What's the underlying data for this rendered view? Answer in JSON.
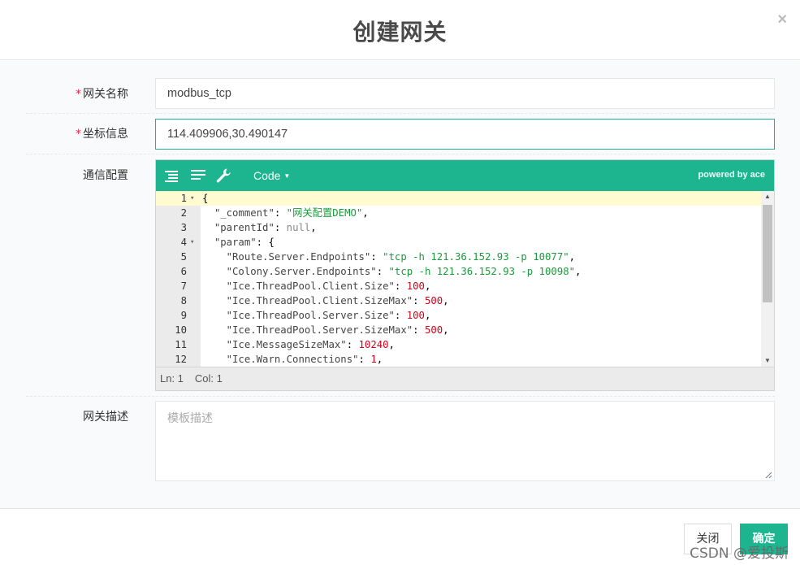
{
  "modal": {
    "title": "创建网关",
    "close_glyph": "×"
  },
  "form": {
    "name": {
      "label": "* 网关名称",
      "required_mark": "*",
      "label_text": "网关名称",
      "value": "modbus_tcp"
    },
    "coords": {
      "label_text": "坐标信息",
      "required_mark": "*",
      "value": "114.409906,30.490147"
    },
    "config": {
      "label_text": "通信配置"
    },
    "desc": {
      "label_text": "网关描述",
      "placeholder": "模板描述"
    }
  },
  "editor": {
    "toolbar": {
      "icons": [
        "format-icon",
        "compact-icon",
        "repair-icon"
      ],
      "mode_label": "Code",
      "mode_caret": "▼",
      "powered_by": "powered by ace"
    },
    "lines": [
      {
        "no": "1",
        "fold": "▾",
        "text": "{"
      },
      {
        "no": "2",
        "fold": "",
        "text": "  \"_comment\": \"网关配置DEMO\","
      },
      {
        "no": "3",
        "fold": "",
        "text": "  \"parentId\": null,"
      },
      {
        "no": "4",
        "fold": "▾",
        "text": "  \"param\": {"
      },
      {
        "no": "5",
        "fold": "",
        "text": "    \"Route.Server.Endpoints\": \"tcp -h 121.36.152.93 -p 10077\","
      },
      {
        "no": "6",
        "fold": "",
        "text": "    \"Colony.Server.Endpoints\": \"tcp -h 121.36.152.93 -p 10098\","
      },
      {
        "no": "7",
        "fold": "",
        "text": "    \"Ice.ThreadPool.Client.Size\": 100,"
      },
      {
        "no": "8",
        "fold": "",
        "text": "    \"Ice.ThreadPool.Client.SizeMax\": 500,"
      },
      {
        "no": "9",
        "fold": "",
        "text": "    \"Ice.ThreadPool.Server.Size\": 100,"
      },
      {
        "no": "10",
        "fold": "",
        "text": "    \"Ice.ThreadPool.Server.SizeMax\": 500,"
      },
      {
        "no": "11",
        "fold": "",
        "text": "    \"Ice.MessageSizeMax\": 10240,"
      },
      {
        "no": "12",
        "fold": "",
        "text": "    \"Ice.Warn.Connections\": 1,"
      }
    ],
    "status": {
      "ln": "Ln: 1",
      "col": "Col: 1"
    },
    "scroll_up": "▲",
    "scroll_down": "▼"
  },
  "footer": {
    "close_label": "关闭",
    "ok_label": "确定"
  },
  "watermark": "CSDN @爱投斯",
  "colors": {
    "accent": "#1db58f",
    "string": "#1a9b3b",
    "number": "#d0021b",
    "null": "#888888",
    "active_line": "#fffbd1"
  }
}
